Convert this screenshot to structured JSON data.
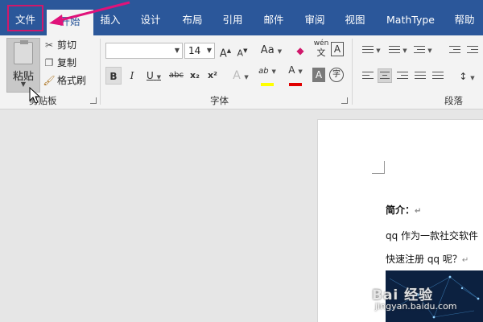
{
  "tabs": {
    "file": "文件",
    "home": "开始",
    "insert": "插入",
    "design": "设计",
    "layout": "布局",
    "references": "引用",
    "mailings": "邮件",
    "review": "审阅",
    "view": "视图",
    "mathtype": "MathType",
    "help": "帮助"
  },
  "clipboard": {
    "paste": "粘贴",
    "cut": "剪切",
    "copy": "复制",
    "format_painter": "格式刷",
    "group_label": "剪贴板"
  },
  "font": {
    "font_name": "",
    "font_size": "14",
    "grow": "A",
    "shrink": "A",
    "case": "Aa",
    "phonetic": "wén",
    "border_char": "A",
    "bold": "B",
    "italic": "I",
    "underline": "U",
    "strikethrough": "abc",
    "subscript": "x₂",
    "superscript": "x²",
    "text_effects": "A",
    "highlight": "ab",
    "font_color": "A",
    "char_shading": "A",
    "enclose": "字",
    "group_label": "字体"
  },
  "paragraph": {
    "group_label": "段落"
  },
  "colors": {
    "accent": "#2b579a",
    "highlight": "#ffff00",
    "font_color": "#e00000",
    "annotation": "#d0186b"
  },
  "document": {
    "heading": "简介：",
    "line1": "qq 作为一款社交软件",
    "line2": "快速注册 qq 呢？",
    "para_mark": "↵"
  },
  "watermark": {
    "brand": "Bai 经验",
    "url": "jingyan.baidu.com"
  }
}
